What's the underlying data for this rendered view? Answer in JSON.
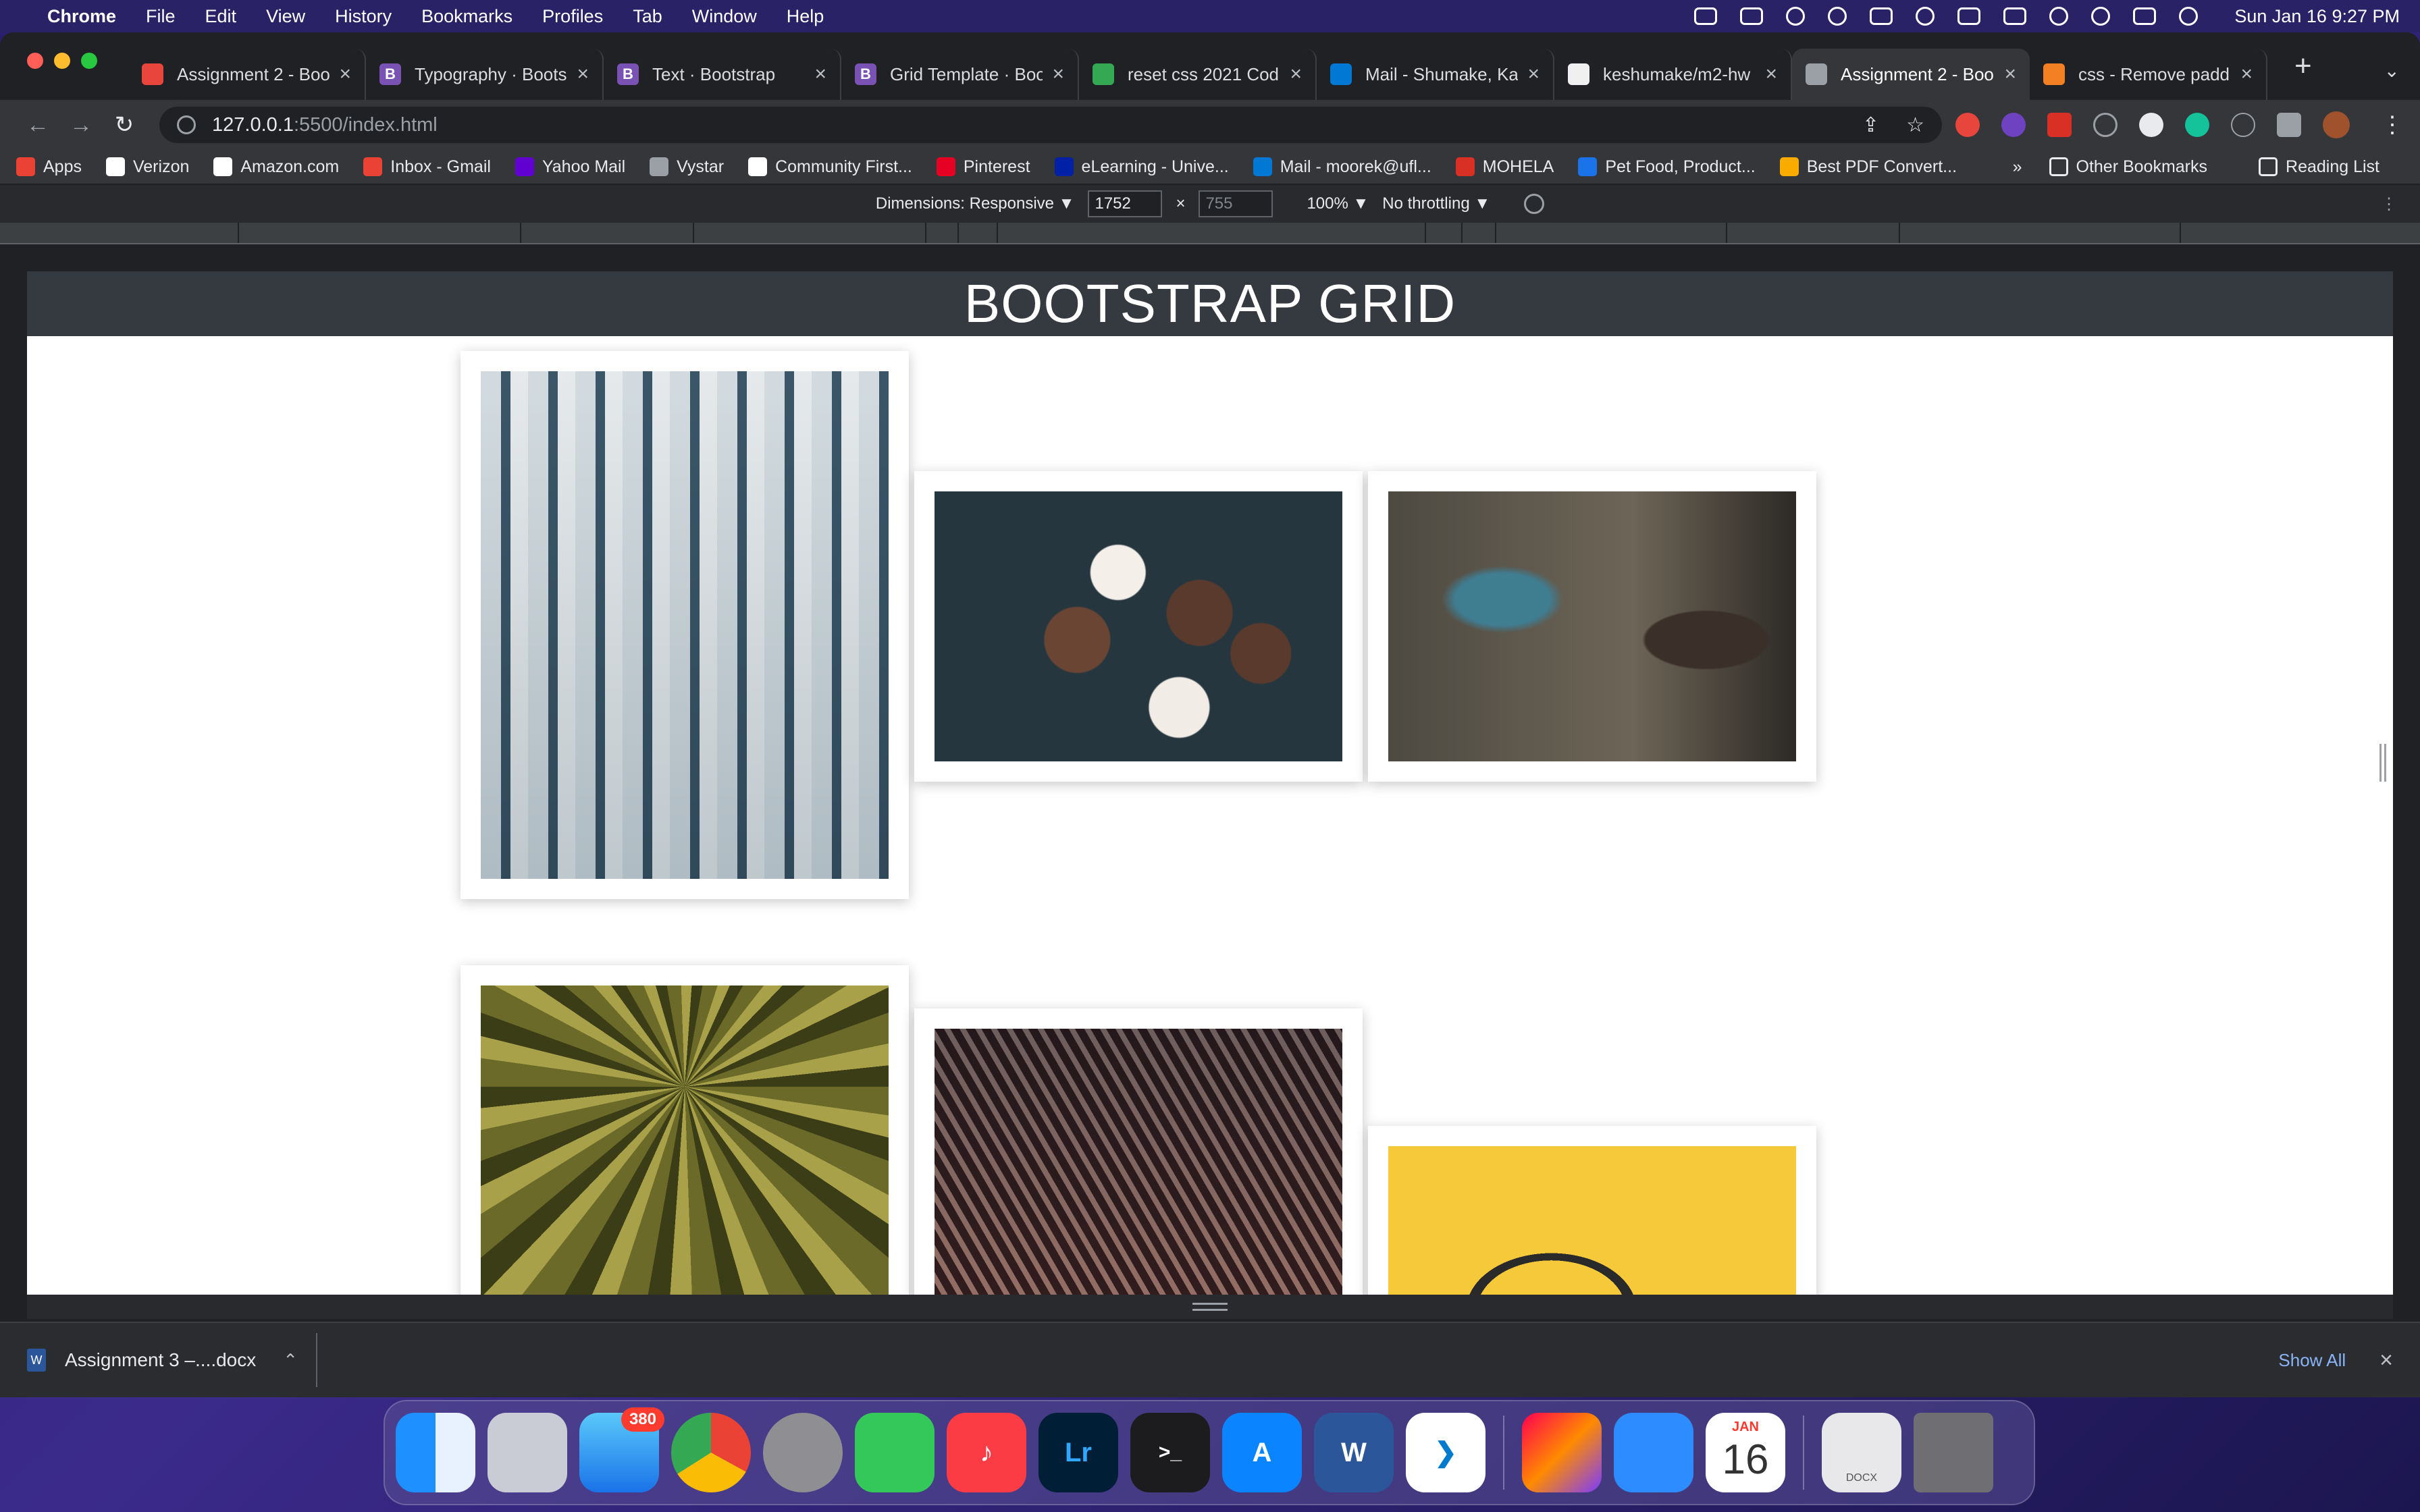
{
  "menubar": {
    "app_name": "Chrome",
    "items": [
      "File",
      "Edit",
      "View",
      "History",
      "Bookmarks",
      "Profiles",
      "Tab",
      "Window",
      "Help"
    ],
    "clock": "Sun Jan 16  9:27 PM"
  },
  "tabs": [
    {
      "title": "Assignment 2 - Boo",
      "favicon": "",
      "color": "#e8453c"
    },
    {
      "title": "Typography · Boots",
      "favicon": "B",
      "color": "#7952b3"
    },
    {
      "title": "Text · Bootstrap",
      "favicon": "B",
      "color": "#7952b3"
    },
    {
      "title": "Grid Template · Boo",
      "favicon": "B",
      "color": "#7952b3"
    },
    {
      "title": "reset css 2021 Cod",
      "favicon": "",
      "color": "#34a853"
    },
    {
      "title": "Mail - Shumake, Ka",
      "favicon": "",
      "color": "#0078d4"
    },
    {
      "title": "keshumake/m2-hw",
      "favicon": "",
      "color": "#f0f0f0"
    },
    {
      "title": "Assignment 2 - Boo",
      "favicon": "",
      "color": "#9aa0a6",
      "active": true
    },
    {
      "title": "css - Remove padd",
      "favicon": "",
      "color": "#f48024"
    }
  ],
  "address": {
    "host": "127.0.0.1",
    "path": ":5500/index.html"
  },
  "bookmarks": [
    {
      "label": "Apps",
      "color": "#ea4335"
    },
    {
      "label": "Verizon",
      "color": "#ffffff"
    },
    {
      "label": "Amazon.com",
      "color": "#ffffff"
    },
    {
      "label": "Inbox - Gmail",
      "color": "#ea4335"
    },
    {
      "label": "Yahoo Mail",
      "color": "#6001d2"
    },
    {
      "label": "Vystar",
      "color": "#9aa0a6"
    },
    {
      "label": "Community First...",
      "color": "#ffffff"
    },
    {
      "label": "Pinterest",
      "color": "#e60023"
    },
    {
      "label": "eLearning - Unive...",
      "color": "#0021a5"
    },
    {
      "label": "Mail - moorek@ufl...",
      "color": "#0078d4"
    },
    {
      "label": "MOHELA",
      "color": "#d93025"
    },
    {
      "label": "Pet Food, Product...",
      "color": "#1a73e8"
    },
    {
      "label": "Best PDF Convert...",
      "color": "#f9ab00"
    }
  ],
  "bookmarks_right": {
    "more": "»",
    "other": "Other Bookmarks",
    "reading": "Reading List"
  },
  "devtools": {
    "dimensions_label": "Dimensions: Responsive ▼",
    "width": "1752",
    "height": "755",
    "zoom": "100% ▼",
    "throttle": "No throttling ▼"
  },
  "page": {
    "heading": "BOOTSTRAP GRID"
  },
  "download": {
    "filename": "Assignment 3 –....docx",
    "show_all": "Show All"
  },
  "dock": {
    "mail_badge": "380",
    "calendar_month": "JAN",
    "calendar_day": "16",
    "doc_label": "DOCX"
  },
  "colors": {
    "bootstrap_purple": "#7952b3",
    "header_dark": "#343a40",
    "link_blue": "#8ab4f8"
  }
}
